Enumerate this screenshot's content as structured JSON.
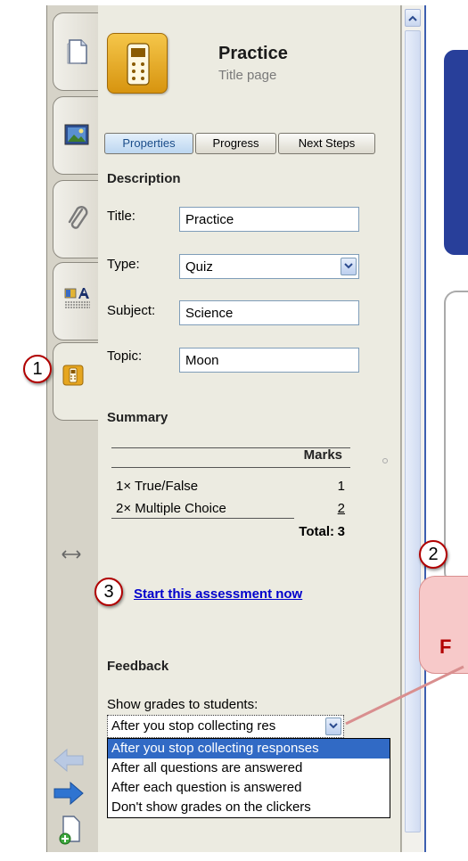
{
  "header": {
    "title": "Practice",
    "subtitle": "Title page"
  },
  "tabs": [
    {
      "label": "Properties",
      "selected": true
    },
    {
      "label": "Progress",
      "selected": false
    },
    {
      "label": "Next Steps",
      "selected": false
    }
  ],
  "description": {
    "heading": "Description",
    "title_label": "Title:",
    "title_value": "Practice",
    "type_label": "Type:",
    "type_value": "Quiz",
    "subject_label": "Subject:",
    "subject_value": "Science",
    "topic_label": "Topic:",
    "topic_value": "Moon"
  },
  "summary": {
    "heading": "Summary",
    "marks_header": "Marks",
    "rows": [
      {
        "label": "1× True/False",
        "marks": "1"
      },
      {
        "label": "2× Multiple Choice",
        "marks": "2"
      }
    ],
    "total_label": "Total:",
    "total_value": "3"
  },
  "start_link": "Start this assessment now",
  "feedback": {
    "heading": "Feedback",
    "show_grades_label": "Show grades to students:",
    "selected_value": "After you stop collecting res",
    "options": [
      "After you stop collecting responses",
      "After all questions are answered",
      "After each question is answered",
      "Don't show grades on the clickers"
    ]
  },
  "callouts": {
    "one": "1",
    "two": "2",
    "three": "3"
  },
  "right_panel_letter": "F",
  "colors": {
    "panel_bg": "#ecebe1",
    "link": "#0000cc",
    "selected_option": "#316ac5",
    "callout_ring": "#b10000",
    "right_bar": "#3d5fb0",
    "bubble": "#f7c9c9"
  },
  "icons": [
    "page-icon",
    "image-icon",
    "attachment-icon",
    "text-style-icon",
    "clicker-icon",
    "resize-arrows-icon",
    "back-arrow-icon",
    "forward-arrow-icon",
    "add-page-icon",
    "scroll-up-icon",
    "dropdown-arrow-icon"
  ]
}
